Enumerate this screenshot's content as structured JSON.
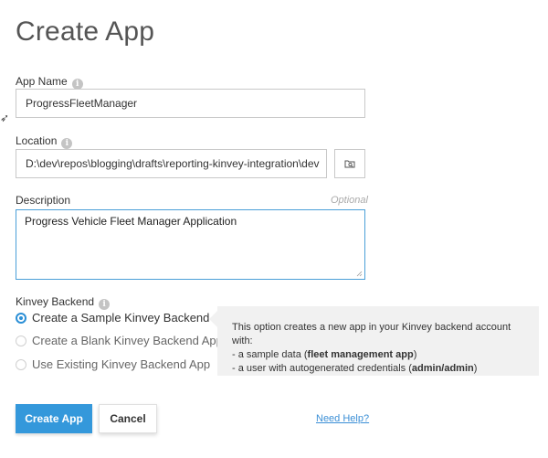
{
  "page": {
    "title": "Create App"
  },
  "app_name": {
    "label": "App Name",
    "value": "ProgressFleetManager"
  },
  "location": {
    "label": "Location",
    "value": "D:\\dev\\repos\\blogging\\drafts\\reporting-kinvey-integration\\dev"
  },
  "description": {
    "label": "Description",
    "optional": "Optional",
    "value": "Progress Vehicle Fleet Manager Application"
  },
  "backend": {
    "label": "Kinvey Backend",
    "options": [
      {
        "label": "Create a Sample Kinvey Backend App",
        "selected": true
      },
      {
        "label": "Create a Blank Kinvey Backend App",
        "selected": false
      },
      {
        "label": "Use Existing Kinvey Backend App",
        "selected": false
      }
    ]
  },
  "tooltip": {
    "line1": "This option creates a new app in your Kinvey backend account with:",
    "line2_prefix": "- a sample data (",
    "line2_bold": "fleet management app",
    "line2_suffix": ")",
    "line3_prefix": "- a user with autogenerated credentials (",
    "line3_bold": "admin/admin",
    "line3_suffix": ")"
  },
  "actions": {
    "create_label": "Create App",
    "cancel_label": "Cancel",
    "help_label": "Need Help?"
  },
  "icons": {
    "info": "info-icon",
    "browse": "folder-browse-icon"
  },
  "colors": {
    "accent": "#3498db",
    "focus_border": "#4a9fd8",
    "link": "#3b8fd6"
  }
}
